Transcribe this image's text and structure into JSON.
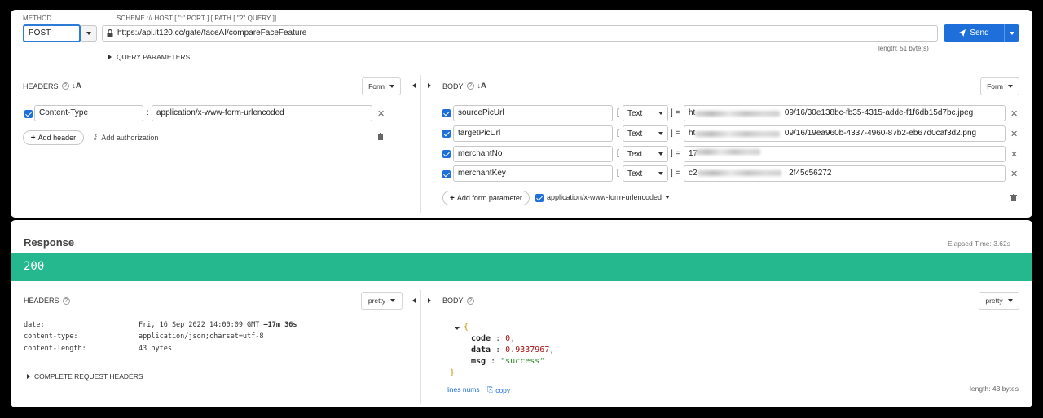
{
  "request": {
    "method_label": "METHOD",
    "method": "POST",
    "url_hint": "SCHEME :// HOST [ \":\" PORT ] [ PATH [ \"?\" QUERY ]]",
    "url": "https://api.it120.cc/gate/faceAI/compareFaceFeature",
    "length": "length: 51 byte(s)",
    "send_label": "Send",
    "query_parameters_label": "QUERY PARAMETERS"
  },
  "headers": {
    "title": "HEADERS",
    "format": "Form",
    "items": [
      {
        "name": "Content-Type",
        "value": "application/x-www-form-urlencoded",
        "separator": ":"
      }
    ],
    "add_header_label": "Add header",
    "add_authorization_label": "Add authorization"
  },
  "body": {
    "title": "BODY",
    "format": "Form",
    "items": [
      {
        "name": "sourcePicUrl",
        "type": "Text",
        "value_prefix": "ht",
        "value_suffix": "09/16/30e138bc-fb35-4315-adde-f1f6db15d7bc.jpeg"
      },
      {
        "name": "targetPicUrl",
        "type": "Text",
        "value_prefix": "ht",
        "value_suffix": "09/16/19ea960b-4337-4960-87b2-eb67d0caf3d2.png"
      },
      {
        "name": "merchantNo",
        "type": "Text",
        "value_prefix": "17",
        "value_suffix": ""
      },
      {
        "name": "merchantKey",
        "type": "Text",
        "value_prefix": "c2",
        "value_suffix": "2f45c56272"
      }
    ],
    "bracket_open": "[",
    "bracket_close_eq": "] =",
    "add_param_label": "Add form parameter",
    "encoding": "application/x-www-form-urlencoded"
  },
  "response": {
    "title": "Response",
    "elapsed": "Elapsed Time: 3.62s",
    "status": "200",
    "status_color": "#25b88f",
    "headers_title": "HEADERS",
    "headers_format": "pretty",
    "headers": [
      {
        "key": "date:",
        "value": "Fri, 16 Sep 2022 14:00:09 GMT",
        "extra": "–17m 36s"
      },
      {
        "key": "content-type:",
        "value": "application/json;charset=utf-8",
        "extra": ""
      },
      {
        "key": "content-length:",
        "value": "43 bytes",
        "extra": ""
      }
    ],
    "complete_headers_label": "COMPLETE REQUEST HEADERS",
    "body_title": "BODY",
    "body_format": "pretty",
    "json": {
      "open": "{",
      "close": "}",
      "fields": [
        {
          "key": "code",
          "value": "0",
          "kind": "num"
        },
        {
          "key": "data",
          "value": "0.9337967",
          "kind": "num"
        },
        {
          "key": "msg",
          "value": "\"success\"",
          "kind": "str"
        }
      ]
    },
    "lines_nums_label": "lines nums",
    "copy_label": "copy",
    "body_length": "length: 43 bytes"
  }
}
